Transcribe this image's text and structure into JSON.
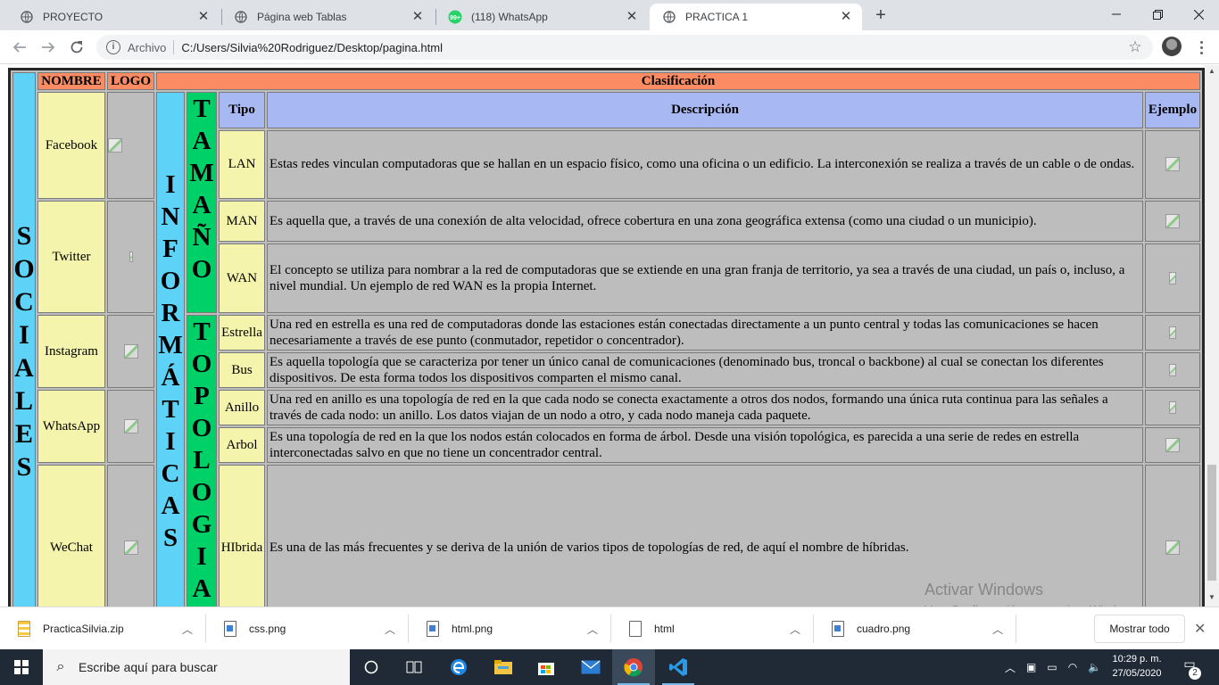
{
  "browser": {
    "tabs": [
      {
        "title": "PROYECTO",
        "icon": "globe-icon",
        "active": false
      },
      {
        "title": "Página web Tablas",
        "icon": "globe-icon",
        "active": false
      },
      {
        "title": "(118) WhatsApp",
        "icon": "whatsapp-icon",
        "badge": "99+",
        "active": false
      },
      {
        "title": "PRACTICA 1",
        "icon": "globe-icon",
        "active": true
      }
    ],
    "new_tab": "+",
    "address": {
      "scheme": "Archivo",
      "url": "C:/Users/Silvia%20Rodriguez/Desktop/pagina.html"
    }
  },
  "page": {
    "headers": {
      "nombre": "NOMBRE",
      "logo": "LOGO",
      "clasificacion": "Clasificación",
      "tipo": "Tipo",
      "descripcion": "Descripción",
      "ejemplo": "Ejemplo"
    },
    "vertical": {
      "sociales": "S\nO\nC\nI\nA\nL\nE\nS",
      "informaticas": "I\nN\nF\nO\nR\nM\nÁ\nT\nI\nC\nA\nS",
      "tamano": "T\nA\nM\nA\nÑ\nO",
      "topologia": "T\nO\nP\nO\nL\nO\nG\nI\nA"
    },
    "social": [
      {
        "name": "Facebook"
      },
      {
        "name": "Twitter"
      },
      {
        "name": "Instagram"
      },
      {
        "name": "WhatsApp"
      },
      {
        "name": "WeChat"
      }
    ],
    "networks": [
      {
        "tipo": "LAN",
        "descripcion": "Estas redes vinculan computadoras que se hallan en un espacio físico, como una oficina o un edificio. La interconexión se realiza a través de un cable o de ondas."
      },
      {
        "tipo": "MAN",
        "descripcion": "Es aquella que, a través de una conexión de alta velocidad, ofrece cobertura en una zona geográfica extensa (como una ciudad o un municipio)."
      },
      {
        "tipo": "WAN",
        "descripcion": "El concepto se utiliza para nombrar a la red de computadoras que se extiende en una gran franja de territorio, ya sea a través de una ciudad, un país o, incluso, a nivel mundial. Un ejemplo de red WAN es la propia Internet."
      },
      {
        "tipo": "Estrella",
        "descripcion": "Una red en estrella es una red de computadoras donde las estaciones están conectadas directamente a un punto central y todas las comunicaciones se hacen necesariamente a través de ese punto (conmutador, repetidor o concentrador)."
      },
      {
        "tipo": "Bus",
        "descripcion": "Es aquella topología que se caracteriza por tener un único canal de comunicaciones (denominado bus, troncal o backbone) al cual se conectan los diferentes dispositivos. De esta forma todos los dispositivos comparten el mismo canal."
      },
      {
        "tipo": "Anillo",
        "descripcion": "Una red en anillo es una topología de red en la que cada nodo se conecta exactamente a otros dos nodos, formando una única ruta continua para las señales a través de cada nodo: un anillo. Los datos viajan de un nodo a otro, y cada nodo maneja cada paquete."
      },
      {
        "tipo": "Arbol",
        "descripcion": "Es una topología de red en la que los nodos están colocados en forma de árbol. Desde una visión topológica, es parecida a una serie de redes en estrella interconectadas salvo en que no tiene un concentrador central."
      },
      {
        "tipo": "HIbrida",
        "descripcion": "Es una de las más frecuentes y se deriva de la unión de varios tipos de topologías de red, de aquí el nombre de híbridas."
      }
    ]
  },
  "watermark": {
    "title": "Activar Windows",
    "subtitle": "Ve a Configuración para activar Windows."
  },
  "downloads": {
    "items": [
      {
        "name": "PracticaSilvia.zip",
        "icon": "zip-file-icon"
      },
      {
        "name": "css.png",
        "icon": "image-file-icon"
      },
      {
        "name": "html.png",
        "icon": "image-file-icon"
      },
      {
        "name": "html",
        "icon": "file-icon"
      },
      {
        "name": "cuadro.png",
        "icon": "image-file-icon"
      }
    ],
    "show_all": "Mostrar todo"
  },
  "taskbar": {
    "search_placeholder": "Escribe aquí para buscar",
    "time": "10:29 p. m.",
    "date": "27/05/2020",
    "notifications": "2"
  }
}
